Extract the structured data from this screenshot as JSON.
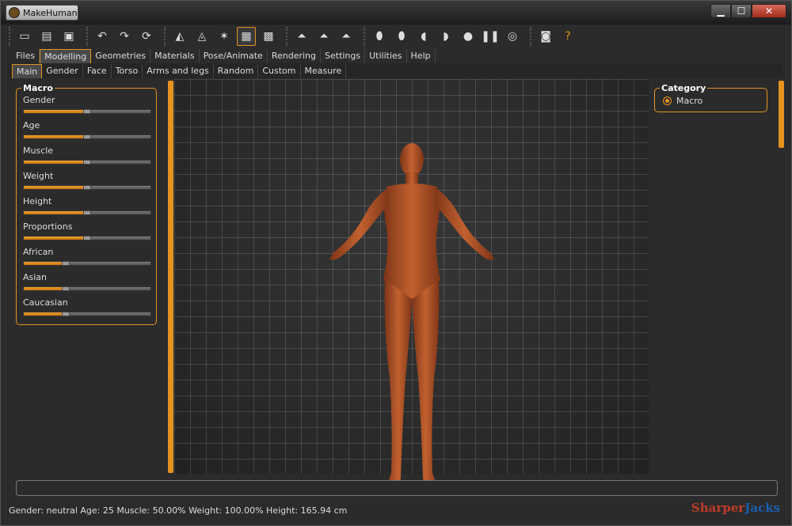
{
  "window": {
    "title": "MakeHuman",
    "minimize": "▁",
    "maximize": "☐",
    "close": "✕"
  },
  "toolbar": {
    "groups": [
      [
        {
          "icon": "new-file-icon",
          "glyph": "▭"
        },
        {
          "icon": "save-icon",
          "glyph": "▤"
        },
        {
          "icon": "export-icon",
          "glyph": "▣"
        }
      ],
      [
        {
          "icon": "undo-icon",
          "glyph": "↶"
        },
        {
          "icon": "redo-icon",
          "glyph": "↷"
        },
        {
          "icon": "reset-icon",
          "glyph": "⟳"
        }
      ],
      [
        {
          "icon": "smooth-icon",
          "glyph": "◭"
        },
        {
          "icon": "wireframe-icon",
          "glyph": "◬"
        },
        {
          "icon": "pose-icon",
          "glyph": "✶"
        },
        {
          "icon": "grid-icon",
          "glyph": "▦",
          "active": true
        },
        {
          "icon": "checker-icon",
          "glyph": "▩"
        }
      ],
      [
        {
          "icon": "front-view-icon",
          "glyph": "⏶"
        },
        {
          "icon": "back-view-icon",
          "glyph": "⏶"
        },
        {
          "icon": "side-view-icon",
          "glyph": "⏶"
        }
      ],
      [
        {
          "icon": "head-front-icon",
          "glyph": "⬮"
        },
        {
          "icon": "head-back-icon",
          "glyph": "⬮"
        },
        {
          "icon": "head-left-icon",
          "glyph": "◖"
        },
        {
          "icon": "head-right-icon",
          "glyph": "◗"
        },
        {
          "icon": "head-top-icon",
          "glyph": "●"
        },
        {
          "icon": "feet-icon",
          "glyph": "❚❚"
        },
        {
          "icon": "reset-camera-icon",
          "glyph": "◎"
        }
      ],
      [
        {
          "icon": "screenshot-icon",
          "glyph": "◙"
        },
        {
          "icon": "help-icon",
          "glyph": "?",
          "orange": true
        }
      ]
    ]
  },
  "tabs": [
    "Files",
    "Modelling",
    "Geometries",
    "Materials",
    "Pose/Animate",
    "Rendering",
    "Settings",
    "Utilities",
    "Help"
  ],
  "active_tab": "Modelling",
  "subtabs": [
    "Main",
    "Gender",
    "Face",
    "Torso",
    "Arms and legs",
    "Random",
    "Custom",
    "Measure"
  ],
  "active_subtab": "Main",
  "macro": {
    "title": "Macro",
    "sliders": [
      {
        "label": "Gender",
        "value": 0.5
      },
      {
        "label": "Age",
        "value": 0.5
      },
      {
        "label": "Muscle",
        "value": 0.5
      },
      {
        "label": "Weight",
        "value": 0.5
      },
      {
        "label": "Height",
        "value": 0.5
      },
      {
        "label": "Proportions",
        "value": 0.5
      },
      {
        "label": "African",
        "value": 0.333
      },
      {
        "label": "Asian",
        "value": 0.333
      },
      {
        "label": "Caucasian",
        "value": 0.333
      }
    ]
  },
  "category": {
    "title": "Category",
    "option": "Macro"
  },
  "status": "Gender: neutral Age: 25 Muscle: 50.00% Weight: 100.00% Height: 165.94 cm",
  "watermark": {
    "part1": "Sharper",
    "part2": "Jacks"
  },
  "colors": {
    "accent": "#e5931f",
    "skin": "#b4552b",
    "background": "#2b2b2b"
  }
}
